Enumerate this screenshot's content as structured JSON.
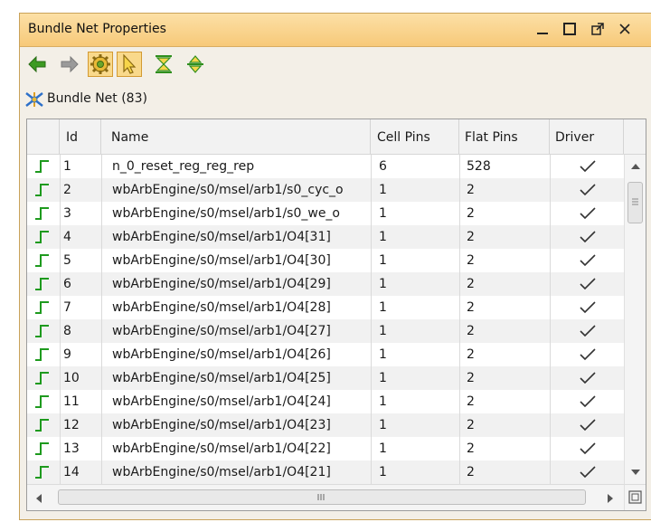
{
  "window": {
    "title": "Bundle Net Properties"
  },
  "window_controls": [
    "minimize-icon",
    "maximize-icon",
    "float-icon",
    "close-icon"
  ],
  "toolbar": {
    "buttons": [
      "back-arrow-icon",
      "forward-arrow-icon",
      "settings-icon",
      "select-pointer-icon",
      "collapse-icon",
      "expand-icon"
    ]
  },
  "bundle": {
    "label": "Bundle Net (83)"
  },
  "table": {
    "headers": {
      "id": "Id",
      "name": "Name",
      "cell_pins": "Cell Pins",
      "flat_pins": "Flat Pins",
      "driver": "Driver"
    },
    "rows": [
      {
        "id": "1",
        "name": "n_0_reset_reg_reg_rep",
        "cell_pins": "6",
        "flat_pins": "528",
        "driver": true
      },
      {
        "id": "2",
        "name": "wbArbEngine/s0/msel/arb1/s0_cyc_o",
        "cell_pins": "1",
        "flat_pins": "2",
        "driver": true
      },
      {
        "id": "3",
        "name": "wbArbEngine/s0/msel/arb1/s0_we_o",
        "cell_pins": "1",
        "flat_pins": "2",
        "driver": true
      },
      {
        "id": "4",
        "name": "wbArbEngine/s0/msel/arb1/O4[31]",
        "cell_pins": "1",
        "flat_pins": "2",
        "driver": true
      },
      {
        "id": "5",
        "name": "wbArbEngine/s0/msel/arb1/O4[30]",
        "cell_pins": "1",
        "flat_pins": "2",
        "driver": true
      },
      {
        "id": "6",
        "name": "wbArbEngine/s0/msel/arb1/O4[29]",
        "cell_pins": "1",
        "flat_pins": "2",
        "driver": true
      },
      {
        "id": "7",
        "name": "wbArbEngine/s0/msel/arb1/O4[28]",
        "cell_pins": "1",
        "flat_pins": "2",
        "driver": true
      },
      {
        "id": "8",
        "name": "wbArbEngine/s0/msel/arb1/O4[27]",
        "cell_pins": "1",
        "flat_pins": "2",
        "driver": true
      },
      {
        "id": "9",
        "name": "wbArbEngine/s0/msel/arb1/O4[26]",
        "cell_pins": "1",
        "flat_pins": "2",
        "driver": true
      },
      {
        "id": "10",
        "name": "wbArbEngine/s0/msel/arb1/O4[25]",
        "cell_pins": "1",
        "flat_pins": "2",
        "driver": true
      },
      {
        "id": "11",
        "name": "wbArbEngine/s0/msel/arb1/O4[24]",
        "cell_pins": "1",
        "flat_pins": "2",
        "driver": true
      },
      {
        "id": "12",
        "name": "wbArbEngine/s0/msel/arb1/O4[23]",
        "cell_pins": "1",
        "flat_pins": "2",
        "driver": true
      },
      {
        "id": "13",
        "name": "wbArbEngine/s0/msel/arb1/O4[22]",
        "cell_pins": "1",
        "flat_pins": "2",
        "driver": true
      },
      {
        "id": "14",
        "name": "wbArbEngine/s0/msel/arb1/O4[21]",
        "cell_pins": "1",
        "flat_pins": "2",
        "driver": true
      }
    ]
  },
  "colors": {
    "titlebar": "#f7c979",
    "net_icon": "#1e9a1e",
    "check": "#333333"
  }
}
